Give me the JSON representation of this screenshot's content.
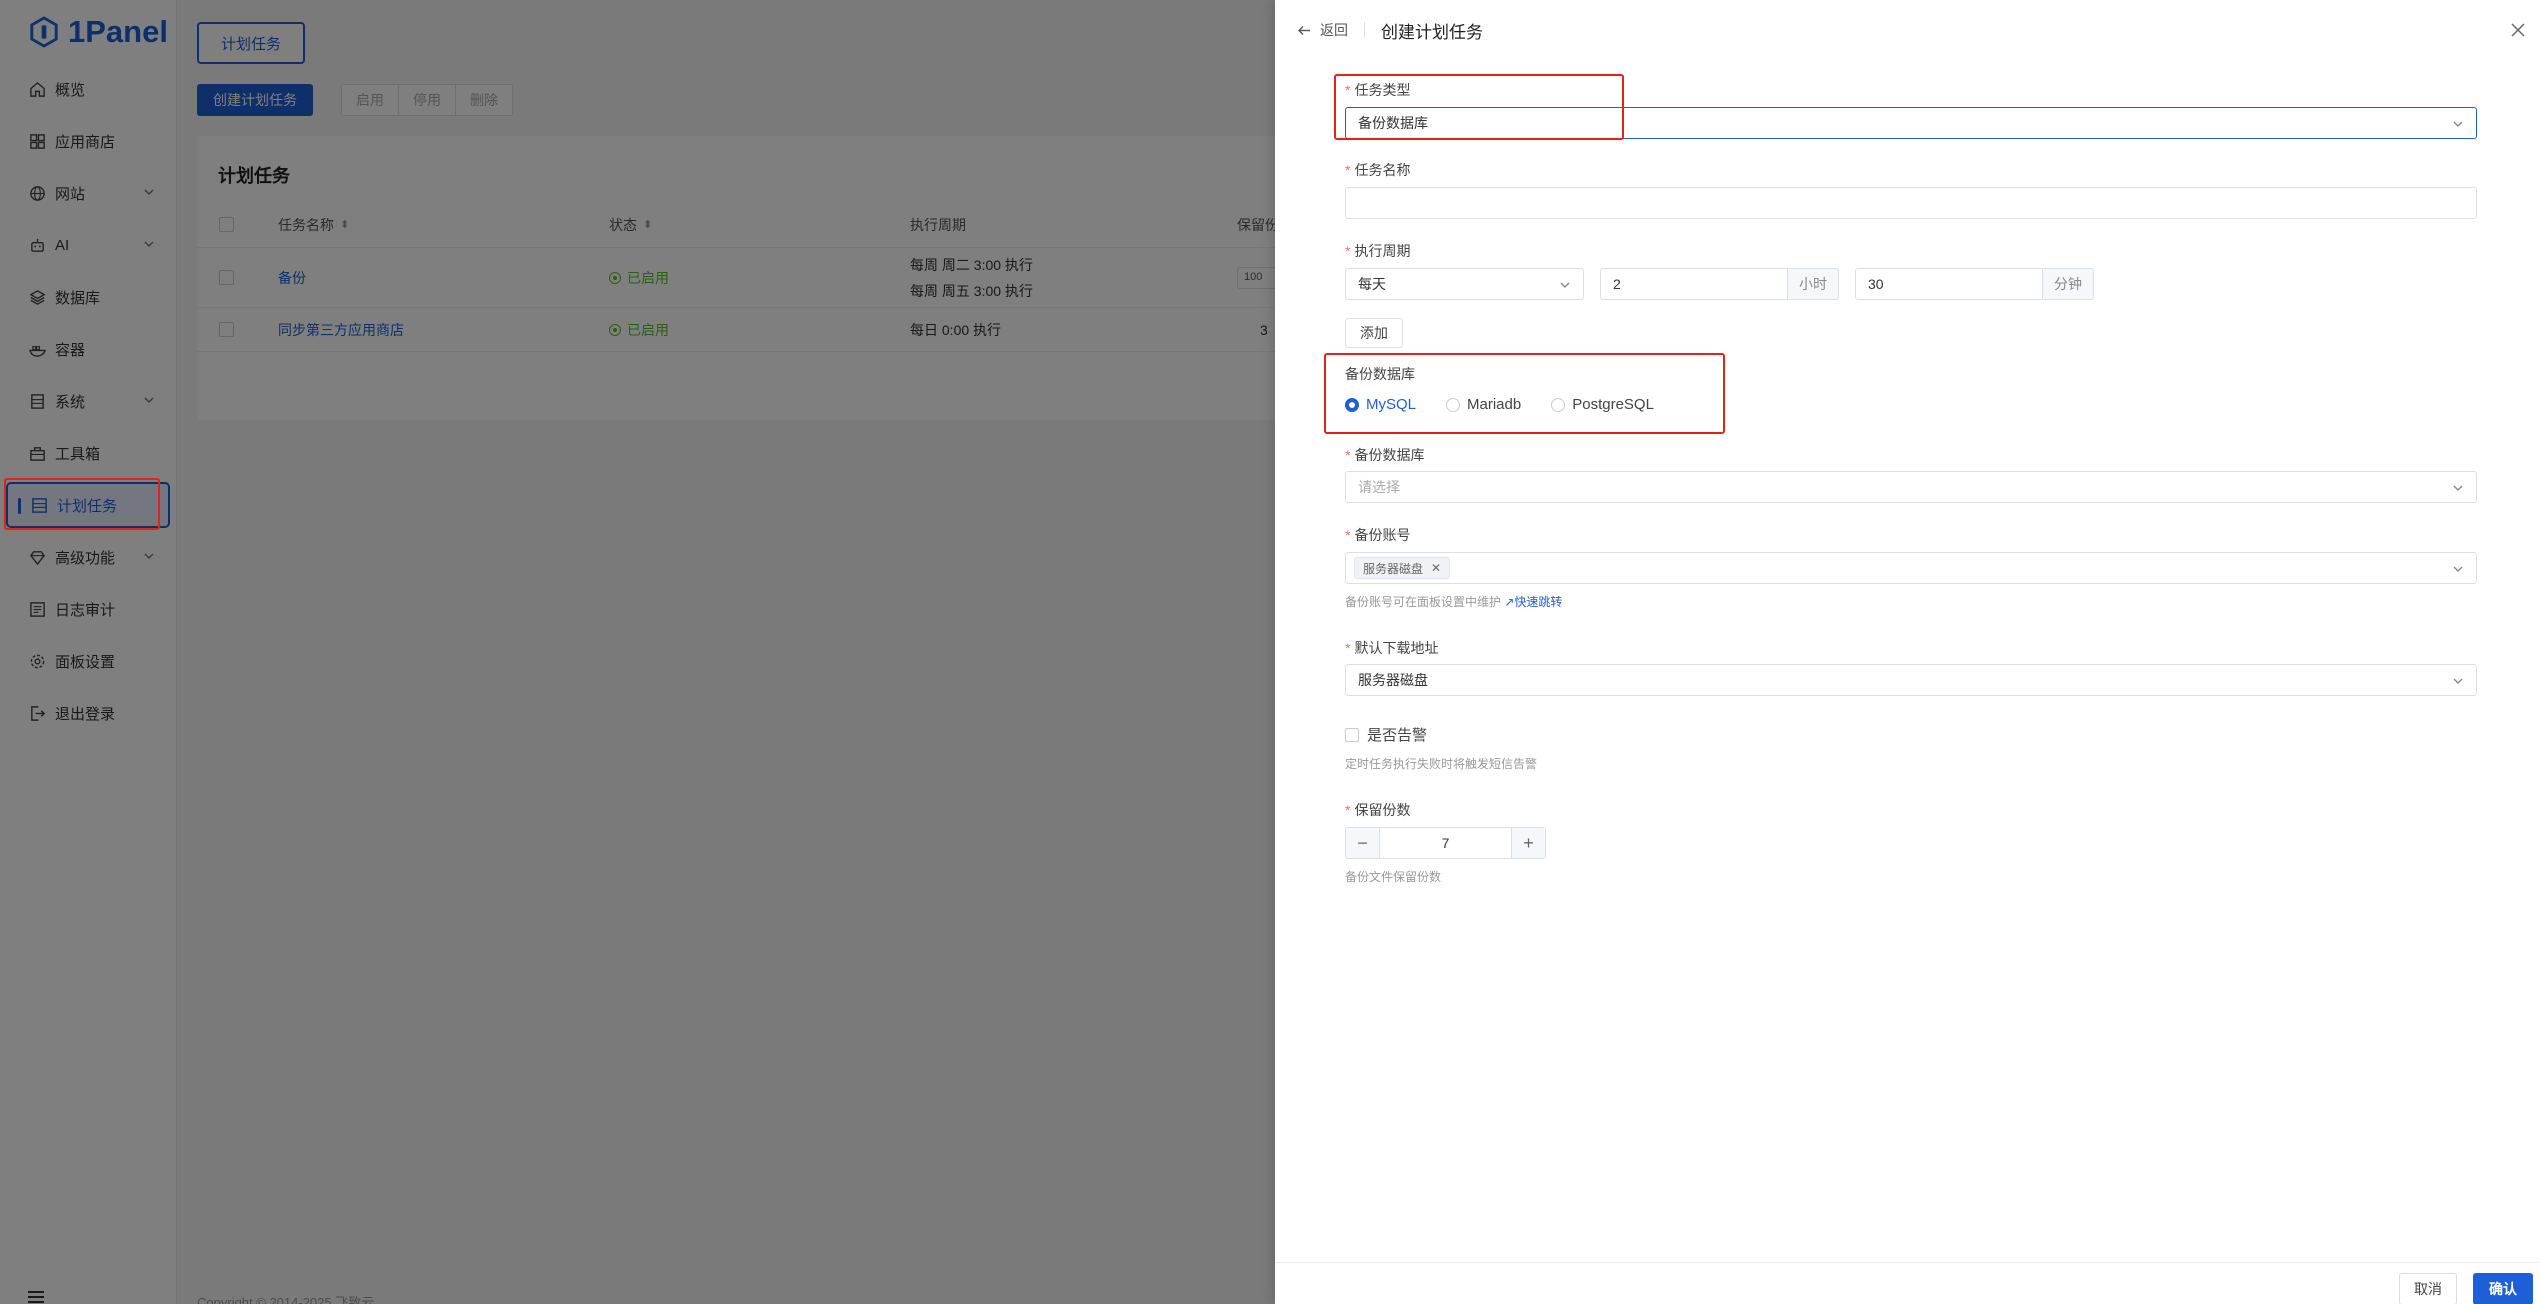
{
  "brand": {
    "name": "1Panel"
  },
  "sidebar": {
    "items": [
      {
        "label": "概览",
        "icon": "home-icon"
      },
      {
        "label": "应用商店",
        "icon": "grid-icon"
      },
      {
        "label": "网站",
        "icon": "globe-icon",
        "expandable": true
      },
      {
        "label": "AI",
        "icon": "robot-icon",
        "expandable": true
      },
      {
        "label": "数据库",
        "icon": "database-icon"
      },
      {
        "label": "容器",
        "icon": "container-icon"
      },
      {
        "label": "系统",
        "icon": "server-icon",
        "expandable": true
      },
      {
        "label": "工具箱",
        "icon": "toolbox-icon"
      },
      {
        "label": "计划任务",
        "icon": "list-icon",
        "active": true
      },
      {
        "label": "高级功能",
        "icon": "diamond-icon",
        "expandable": true
      },
      {
        "label": "日志审计",
        "icon": "log-icon"
      },
      {
        "label": "面板设置",
        "icon": "gear-icon"
      },
      {
        "label": "退出登录",
        "icon": "logout-icon"
      }
    ]
  },
  "main": {
    "tab": "计划任务",
    "toolbar": {
      "create": "创建计划任务",
      "enable": "启用",
      "disable": "停用",
      "delete": "删除"
    },
    "card_title": "计划任务",
    "table": {
      "headers": {
        "name": "任务名称",
        "status": "状态",
        "cycle": "执行周期",
        "retain": "保留份"
      },
      "rows": [
        {
          "name": "备份",
          "status": "已启用",
          "cycle1": "每周 周二 3:00 执行",
          "cycle2": "每周 周五 3:00 执行",
          "retain": "100"
        },
        {
          "name": "同步第三方应用商店",
          "status": "已启用",
          "cycle1": "每日 0:00 执行",
          "cycle2": "",
          "retain": "3"
        }
      ]
    },
    "copyright": "Copyright © 2014-2025 飞致云"
  },
  "drawer": {
    "back": "返回",
    "title": "创建计划任务",
    "task_type": {
      "label": "任务类型",
      "value": "备份数据库"
    },
    "task_name": {
      "label": "任务名称",
      "value": ""
    },
    "cycle": {
      "label": "执行周期",
      "freq": "每天",
      "hour": "2",
      "hour_unit": "小时",
      "minute": "30",
      "minute_unit": "分钟",
      "add": "添加"
    },
    "db_type": {
      "label": "备份数据库",
      "options": [
        "MySQL",
        "Mariadb",
        "PostgreSQL"
      ],
      "selected": "MySQL"
    },
    "db": {
      "label": "备份数据库",
      "placeholder": "请选择"
    },
    "account": {
      "label": "备份账号",
      "tag": "服务器磁盘",
      "hint": "备份账号可在面板设置中维护",
      "hint_link": "快速跳转"
    },
    "download": {
      "label": "默认下载地址",
      "value": "服务器磁盘"
    },
    "alert": {
      "label": "是否告警",
      "hint": "定时任务执行失败时将触发短信告警"
    },
    "retain": {
      "label": "保留份数",
      "value": "7",
      "hint": "备份文件保留份数"
    },
    "footer": {
      "cancel": "取消",
      "confirm": "确认"
    }
  },
  "colors": {
    "primary": "#1f5fd6",
    "highlight": "#e2231a",
    "success": "#52c41a"
  }
}
